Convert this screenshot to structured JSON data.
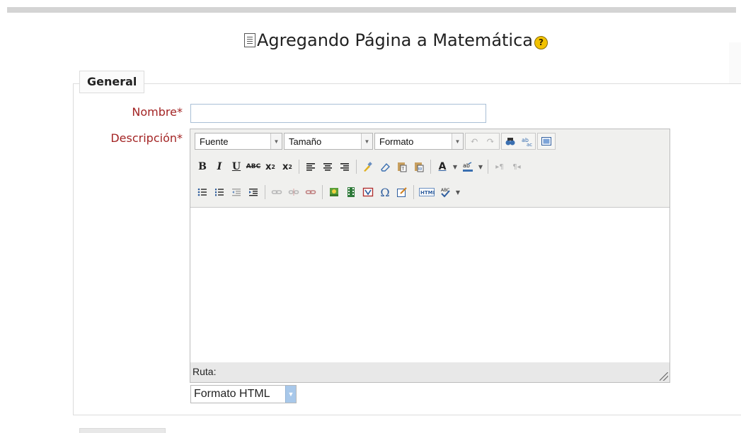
{
  "page": {
    "title": "Agregando Página a Matemática"
  },
  "section": {
    "legend": "General"
  },
  "form": {
    "name_label": "Nombre*",
    "name_value": "",
    "description_label": "Descripción*"
  },
  "editor": {
    "font_select": "Fuente",
    "size_select": "Tamaño",
    "format_select": "Formato",
    "status_path_label": "Ruta:",
    "content": ""
  },
  "format_dropdown": {
    "selected": "Formato HTML"
  },
  "colors": {
    "required_label": "#a32424",
    "help_icon": "#f2c200",
    "input_border": "#a9bfd6"
  }
}
